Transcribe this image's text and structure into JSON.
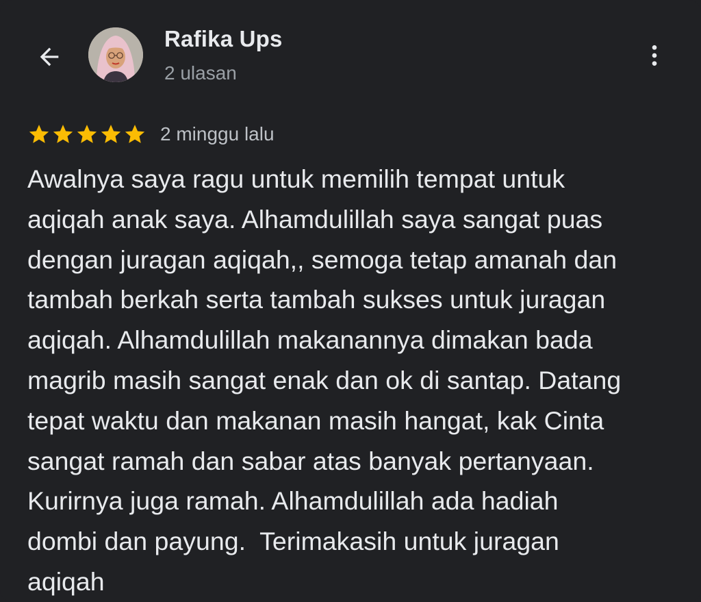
{
  "header": {
    "back_icon": "arrow-back-icon",
    "avatar_icon": "user-avatar",
    "reviewer_name": "Rafika Ups",
    "review_count": "2 ulasan",
    "more_icon": "more-vert-icon"
  },
  "review": {
    "rating": 5,
    "rating_max": 5,
    "star_color": "#fbbc04",
    "time_ago": "2 minggu lalu",
    "text": "Awalnya saya ragu untuk memilih tempat untuk\naqiqah anak saya. Alhamdulillah saya sangat puas\ndengan juragan aqiqah,, semoga tetap amanah dan\ntambah berkah serta tambah sukses untuk juragan\naqiqah. Alhamdulillah makanannya dimakan bada\nmagrib masih sangat enak dan ok di santap. Datang\ntepat waktu dan makanan masih hangat, kak Cinta\nsangat ramah dan sabar atas banyak pertanyaan.\nKurirnya juga ramah. Alhamdulillah ada hadiah\ndombi dan payung.  Terimakasih untuk juragan\naqiqah"
  },
  "colors": {
    "background": "#202124",
    "primary_text": "#e8eaed",
    "secondary_text": "#9aa0a6"
  }
}
